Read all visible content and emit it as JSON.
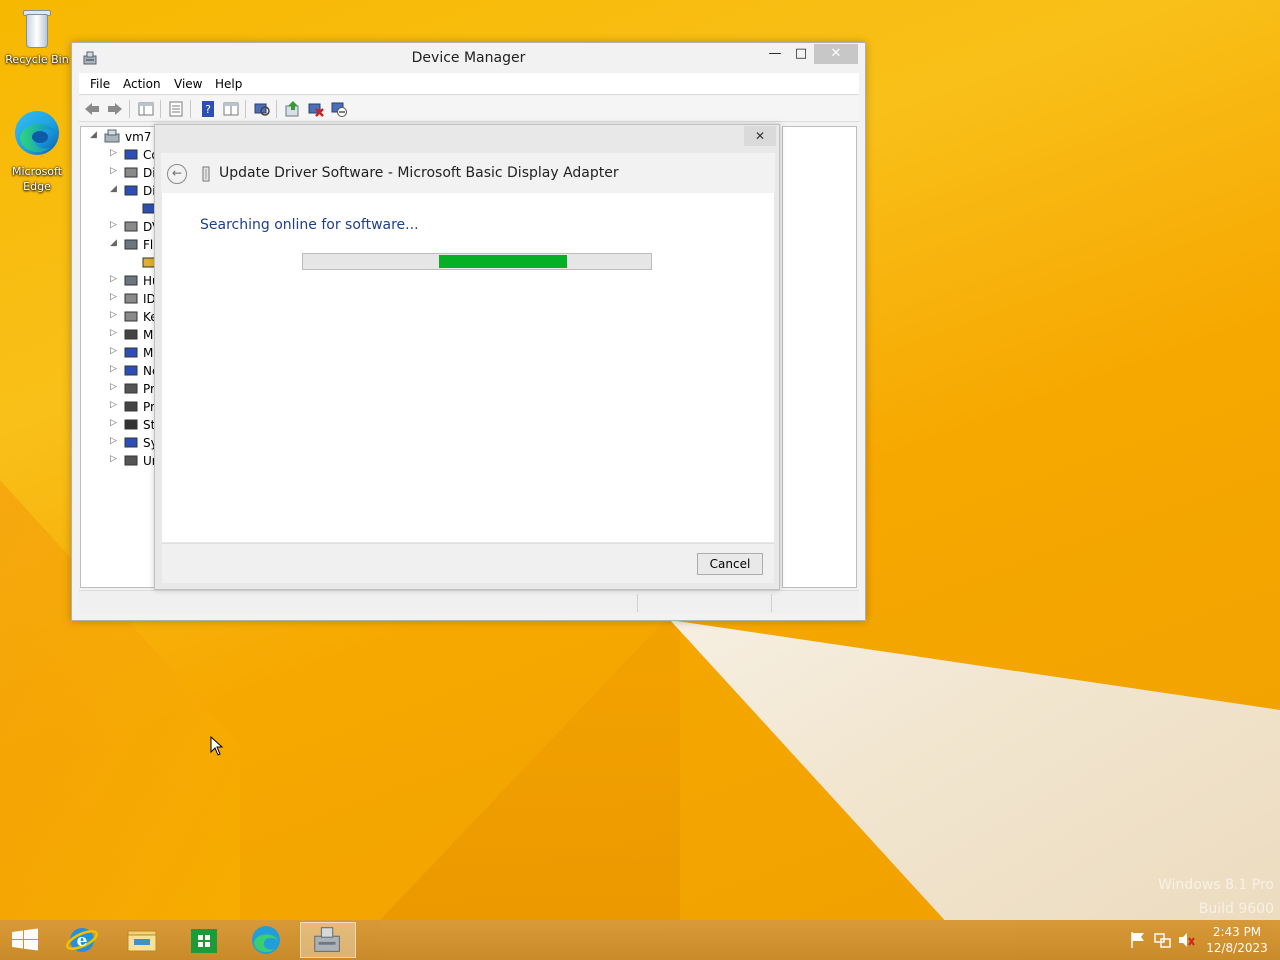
{
  "desktop": {
    "icons": [
      {
        "label": "Recycle Bin",
        "icon": "recycle-bin-icon"
      },
      {
        "label": "Microsoft Edge",
        "icon": "edge-icon"
      }
    ],
    "watermark": {
      "line1": "Windows 8.1 Pro",
      "line2": "Build 9600"
    }
  },
  "device_manager": {
    "title": "Device Manager",
    "menu": [
      "File",
      "Action",
      "View",
      "Help"
    ],
    "tree": {
      "root": "vm7",
      "items": [
        "Co",
        "Di",
        "Di",
        "",
        "DV",
        "Fl",
        "",
        "Hu",
        "ID",
        "Ke",
        "M",
        "M",
        "Ne",
        "Pr",
        "Pr",
        "St",
        "Sy",
        "Ur"
      ]
    }
  },
  "dialog": {
    "title": "Update Driver Software - Microsoft Basic Display Adapter",
    "status": "Searching online for software...",
    "progress": {
      "start_fraction": 0.39,
      "end_fraction": 0.76
    },
    "cancel_label": "Cancel",
    "close_label": "✕"
  },
  "taskbar": {
    "time": "2:43 PM",
    "date": "12/8/2023"
  },
  "colors": {
    "accent_green": "#06b025",
    "status_text": "#1e3f8c",
    "taskbar": "#d89a3a"
  }
}
